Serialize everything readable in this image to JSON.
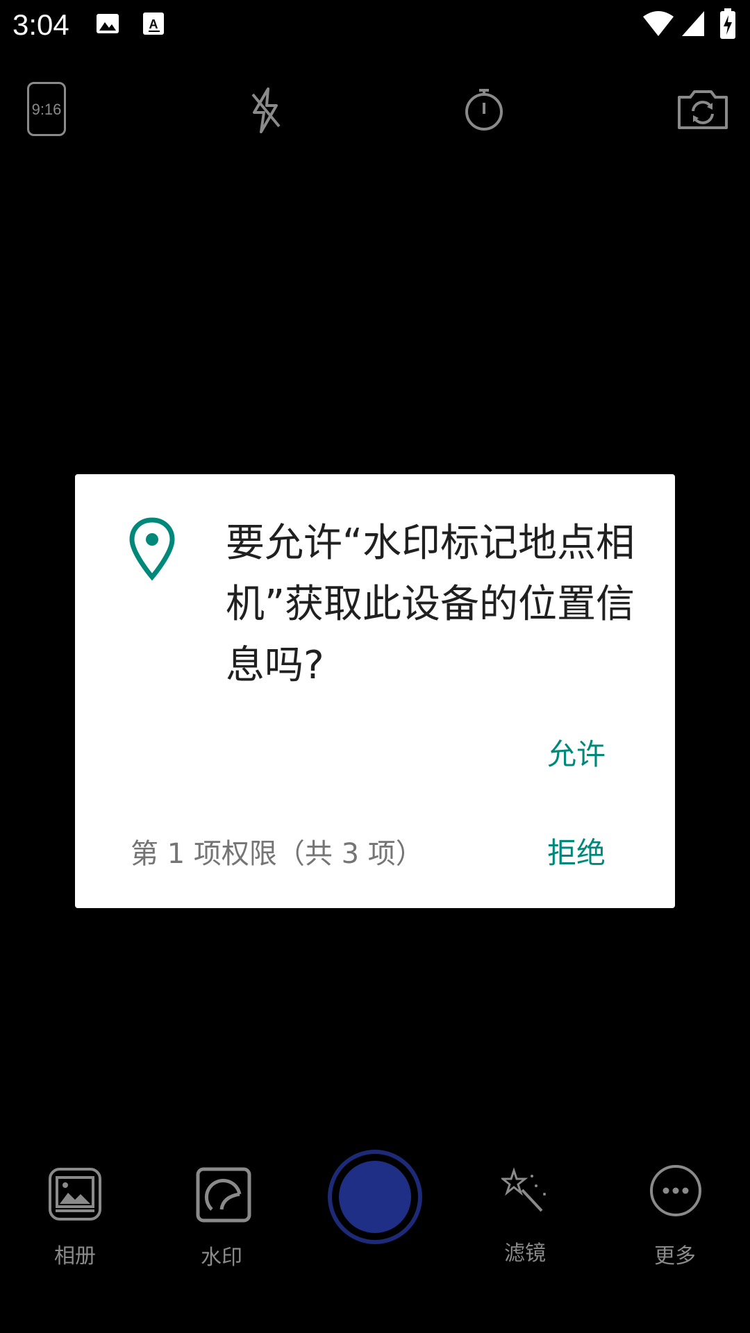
{
  "status_bar": {
    "time": "3:04",
    "icons": [
      "image-icon",
      "text-recognition-icon",
      "wifi-icon",
      "signal-icon",
      "battery-charging-icon"
    ]
  },
  "toolbar": {
    "ratio_label": "9:16",
    "icons": [
      "aspect-ratio-icon",
      "flash-off-icon",
      "timer-icon",
      "switch-camera-icon"
    ]
  },
  "dialog": {
    "message": "要允许“水印标记地点相机”获取此设备的位置信息吗?",
    "allow_label": "允许",
    "deny_label": "拒绝",
    "counter": "第 1 项权限（共 3 项）",
    "accent_color": "#00897b"
  },
  "bottom_bar": {
    "album_label": "相册",
    "watermark_label": "水印",
    "filter_label": "滤镜",
    "more_label": "更多",
    "shutter_color": "#1f2f86"
  }
}
